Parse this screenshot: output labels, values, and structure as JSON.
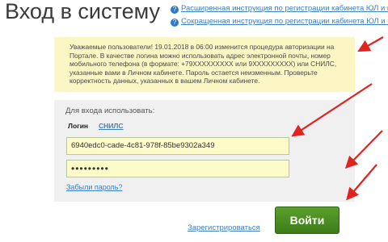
{
  "header": {
    "title": "Вход в систему",
    "links": [
      {
        "icon": "help-icon",
        "icon_glyph": "?",
        "label": "Расширенная инструкция по регистрации кабинета ЮЛ и кабинета"
      },
      {
        "icon": "help-icon",
        "icon_glyph": "?",
        "label": "Сокращенная инструкция по регистрации кабинета ЮЛ и кабинета"
      }
    ]
  },
  "notice": {
    "text": "Уважаемые пользователи! 19.01.2018 в 06:00 изменится процедура авторизации на Портале. В качестве логина можно использовать адрес электронной почты, номер мобильного телефона (в формате: +79XXXXXXXXX или 9XXXXXXXXX) или СНИЛС, указанные вами в Личном кабинете. Пароль остается неизменным. Проверьте корректность данных, указанных в вашем Личном кабинете."
  },
  "login_form": {
    "use_label": "Для входа использовать:",
    "tabs": [
      {
        "label": "Логин",
        "active": true
      },
      {
        "label": "СНИЛС",
        "active": false
      }
    ],
    "login_value": "6940edc0-cade-4c81-978f-85be9302a349",
    "password_value": "•••••••••",
    "forgot_password_label": "Забыли пароль?"
  },
  "footer": {
    "register_label": "Зарегистрироваться",
    "submit_label": "Войти"
  },
  "colors": {
    "notice_background": "#fbf6c3",
    "field_background": "#fdfbc8",
    "link": "#3d7fc0",
    "button": "#4a8f22",
    "annotation_arrow": "#e0241f"
  }
}
